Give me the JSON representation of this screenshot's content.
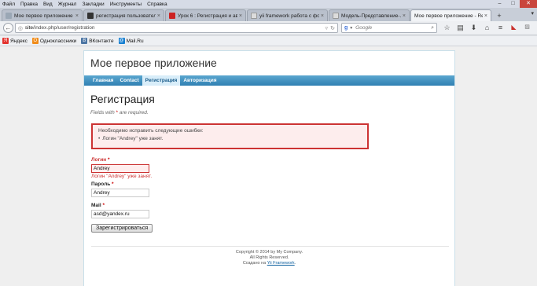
{
  "menubar": {
    "items": [
      "Файл",
      "Правка",
      "Вид",
      "Журнал",
      "Закладки",
      "Инструменты",
      "Справка"
    ]
  },
  "window_controls": {
    "minimize": "–",
    "maximize": "□",
    "close": "✕"
  },
  "tabs": [
    {
      "title": "Мое первое приложение - Re...",
      "active": false,
      "favicon_color": "#9aa7b5"
    },
    {
      "title": "регистрация пользовател...",
      "active": false,
      "favicon_color": "#333333"
    },
    {
      "title": "Урок 6 : Регистрация и ав...",
      "active": false,
      "favicon_color": "#cc2222"
    },
    {
      "title": "yii framework работа с фо...",
      "active": false,
      "favicon_color": "#dcdcdc"
    },
    {
      "title": "Модель-Представление-...",
      "active": false,
      "favicon_color": "#dcdcdc"
    },
    {
      "title": "Мое первое приложение - Re...",
      "active": true,
      "favicon_color": "#9aa7b5"
    }
  ],
  "tab_add": "+",
  "tab_list": "▾",
  "navbar": {
    "url_host": "site",
    "url_path": "/index.php/user/registration",
    "search_placeholder": "Google",
    "search_engine": "g"
  },
  "bookmarks": [
    {
      "label": "Яндекс",
      "icon_char": "Я",
      "color": "#e3342f"
    },
    {
      "label": "Одноклассники",
      "icon_char": "O",
      "color": "#f08c1a"
    },
    {
      "label": "ВКонтакте",
      "icon_char": "B",
      "color": "#4c75a3"
    },
    {
      "label": "Mail.Ru",
      "icon_char": "@",
      "color": "#167fd1"
    }
  ],
  "page": {
    "logo": "Мое первое приложение",
    "menu": [
      {
        "label": "Главная",
        "active": false
      },
      {
        "label": "Contact",
        "active": false
      },
      {
        "label": "Регистрация",
        "active": true
      },
      {
        "label": "Авторизация",
        "active": false
      }
    ],
    "title": "Регистрация",
    "required_note_pre": "Fields with ",
    "required_note_star": "*",
    "required_note_post": " are required.",
    "error_summary": {
      "header": "Необходимо исправить следующие ошибки:",
      "items": [
        "Логин \"Andrey\" уже занят."
      ]
    },
    "form": {
      "login_label": "Логин",
      "login_value": "Andrey",
      "login_error": "Логин \"Andrey\" уже занят.",
      "password_label": "Пароль",
      "password_value": "Andrey",
      "mail_label": "Mail",
      "mail_value": "asd@yandex.ru",
      "required_mark": "*",
      "submit_label": "Зарегистрироваться"
    },
    "footer": {
      "line1": "Copyright © 2014 by My Company.",
      "line2": "All Rights Reserved.",
      "line3_pre": "Создано на ",
      "line3_link": "Yii Framework",
      "line3_post": "."
    }
  }
}
